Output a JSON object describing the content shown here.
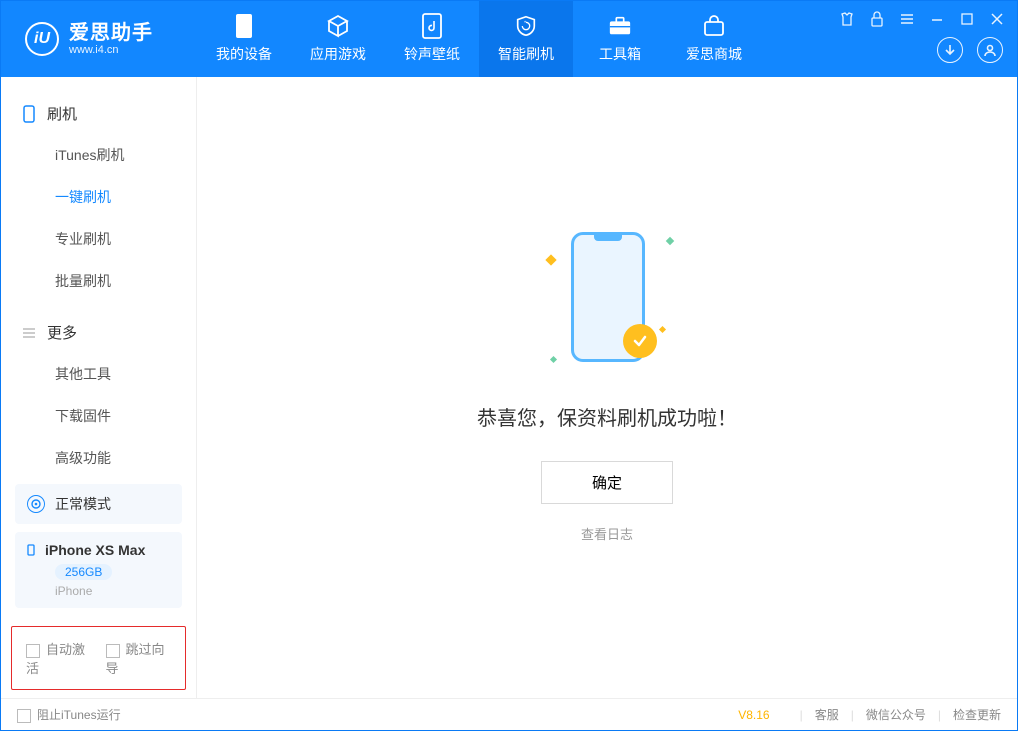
{
  "brand": {
    "name": "爱思助手",
    "site": "www.i4.cn",
    "glyph": "iU"
  },
  "nav": {
    "items": [
      {
        "key": "device",
        "label": "我的设备"
      },
      {
        "key": "apps",
        "label": "应用游戏"
      },
      {
        "key": "ring",
        "label": "铃声壁纸"
      },
      {
        "key": "flash",
        "label": "智能刷机"
      },
      {
        "key": "tools",
        "label": "工具箱"
      },
      {
        "key": "store",
        "label": "爱思商城"
      }
    ],
    "active": "flash"
  },
  "sidebar": {
    "groups": [
      {
        "key": "flash",
        "title": "刷机",
        "items": [
          "iTunes刷机",
          "一键刷机",
          "专业刷机",
          "批量刷机"
        ],
        "activeIndex": 1
      },
      {
        "key": "more",
        "title": "更多",
        "items": [
          "其他工具",
          "下载固件",
          "高级功能"
        ],
        "activeIndex": -1
      }
    ],
    "mode_label": "正常模式",
    "device": {
      "name": "iPhone XS Max",
      "capacity": "256GB",
      "kind": "iPhone"
    },
    "options": {
      "auto_activate": "自动激活",
      "skip_guide": "跳过向导"
    }
  },
  "main": {
    "result_text": "恭喜您，保资料刷机成功啦！",
    "ok_label": "确定",
    "log_link": "查看日志"
  },
  "footer": {
    "block_itunes": "阻止iTunes运行",
    "version": "V8.16",
    "links": [
      "客服",
      "微信公众号",
      "检查更新"
    ]
  }
}
